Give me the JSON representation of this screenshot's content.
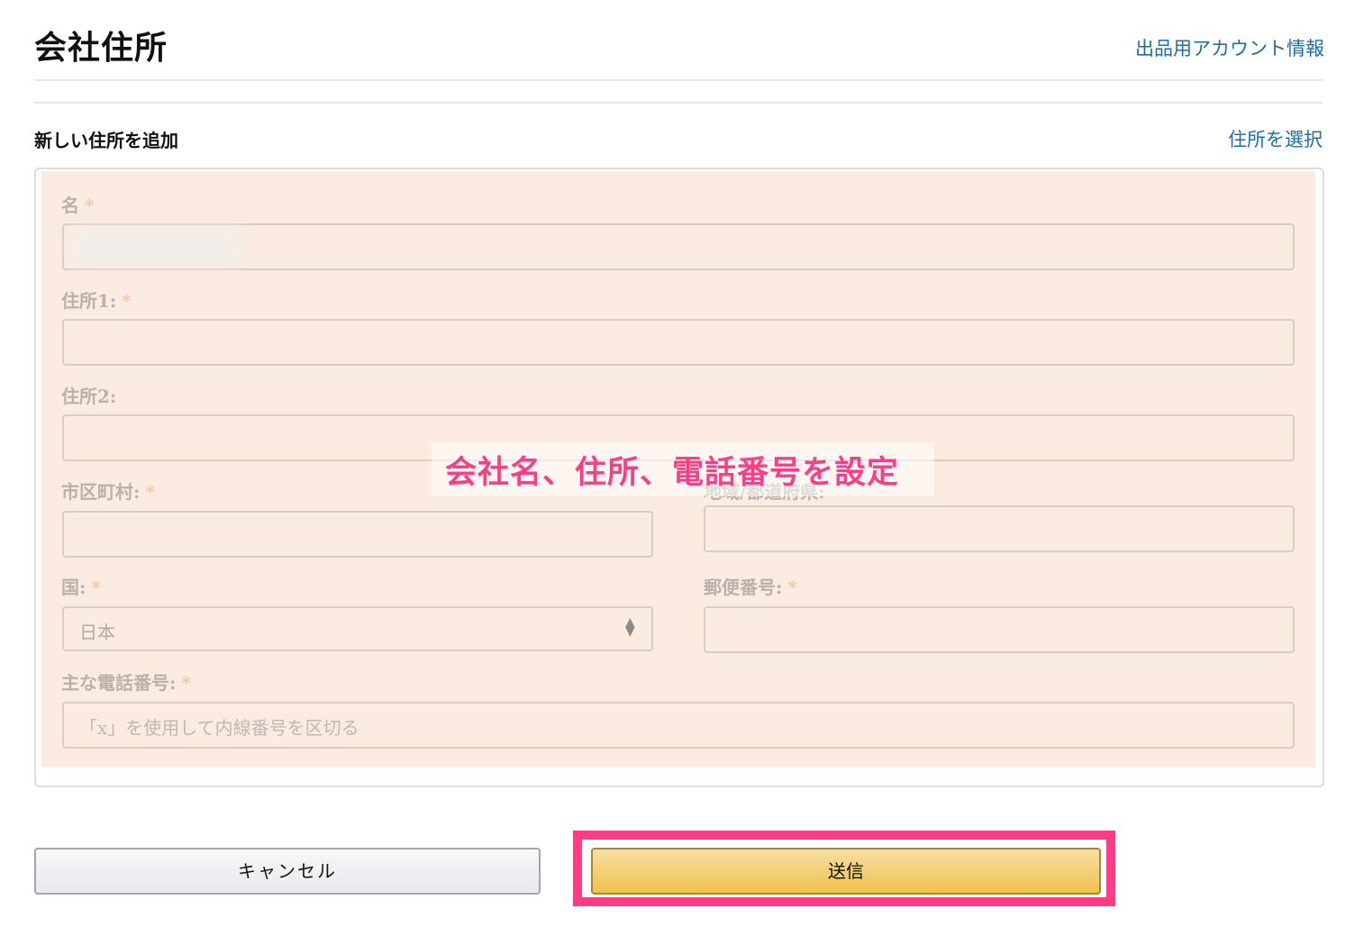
{
  "header": {
    "title": "会社住所",
    "account_link": "出品用アカウント情報"
  },
  "section": {
    "title": "新しい住所を追加",
    "select_address_link": "住所を選択"
  },
  "form": {
    "required_mark": "*",
    "name": {
      "label": "名",
      "value": ""
    },
    "address1": {
      "label": "住所1:",
      "value": ""
    },
    "address2": {
      "label": "住所2:",
      "value": ""
    },
    "city": {
      "label": "市区町村:",
      "value": ""
    },
    "region": {
      "label": "地域/都道府県:",
      "value": ""
    },
    "country": {
      "label": "国:",
      "selected": "日本"
    },
    "postal": {
      "label": "郵便番号:",
      "value": ""
    },
    "phone": {
      "label": "主な電話番号:",
      "placeholder": "「x」を使用して内線番号を区切る"
    }
  },
  "annotation": {
    "text": "会社名、住所、電話番号を設定",
    "color": "#ff3d86"
  },
  "buttons": {
    "cancel": "キャンセル",
    "submit": "送信"
  },
  "colors": {
    "link": "#1e6ea8",
    "overlay": "#fbebe1",
    "highlight": "#ff3d86",
    "submit_button": "#f0c14b"
  }
}
